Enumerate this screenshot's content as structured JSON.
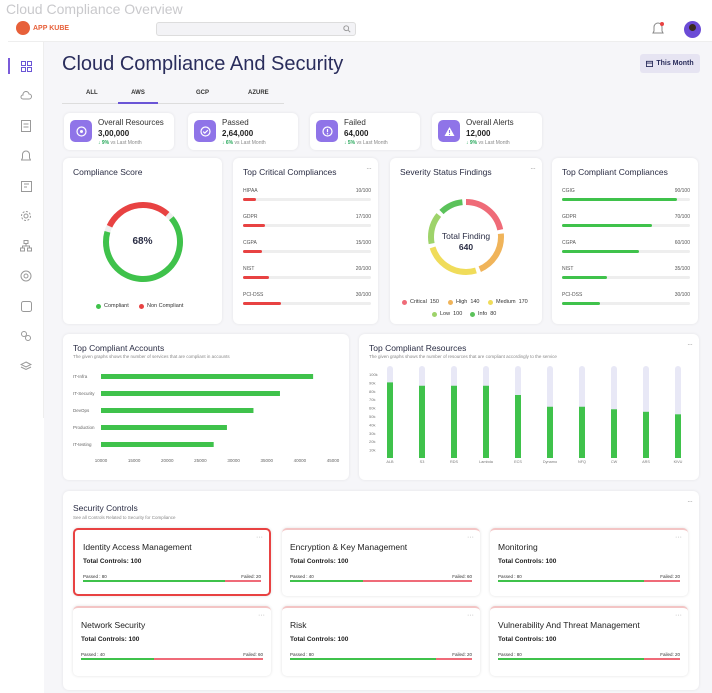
{
  "window_title": "Cloud Compliance Overview",
  "brand": {
    "name": "APP KUBE",
    "accent": "#e7603a"
  },
  "page": {
    "title": "Cloud Compliance And Security",
    "period_button": "This Month"
  },
  "tabs": [
    {
      "label": "ALL",
      "active": false
    },
    {
      "label": "AWS",
      "active": true
    },
    {
      "label": "GCP",
      "active": false
    },
    {
      "label": "AZURE",
      "active": false
    }
  ],
  "stats": [
    {
      "title": "Overall Resources",
      "value": "3,00,000",
      "change": "9%",
      "note": "vs Last Month",
      "icon": "cube-icon"
    },
    {
      "title": "Passed",
      "value": "2,64,000",
      "change": "6%",
      "note": "vs Last Month",
      "icon": "check-icon"
    },
    {
      "title": "Failed",
      "value": "64,000",
      "change": "5%",
      "note": "vs Last Month",
      "icon": "alert-circle-icon"
    },
    {
      "title": "Overall Alerts",
      "value": "12,000",
      "change": "9%",
      "note": "vs Last Month",
      "icon": "warning-icon"
    }
  ],
  "compliance_score": {
    "title": "Compliance Score",
    "value": "68%",
    "percent": 68,
    "legend": [
      {
        "label": "Compliant",
        "color": "#3fc24b"
      },
      {
        "label": "Non Compliant",
        "color": "#e84242"
      }
    ]
  },
  "critical": {
    "title": "Top Critical Compliances",
    "items": [
      {
        "name": "HIPAA",
        "score": "10/100",
        "value": 10
      },
      {
        "name": "GDPR",
        "score": "17/100",
        "value": 17
      },
      {
        "name": "CGPA",
        "score": "15/100",
        "value": 15
      },
      {
        "name": "NIST",
        "score": "20/100",
        "value": 20
      },
      {
        "name": "PCI-DSS",
        "score": "30/100",
        "value": 30
      }
    ]
  },
  "severity": {
    "title": "Severity Status Findings",
    "center_label": "Total Finding",
    "center_value": "640",
    "items": [
      {
        "label": "Critical",
        "value": 150,
        "color": "#ef6b78"
      },
      {
        "label": "High",
        "value": 140,
        "color": "#f0b45a"
      },
      {
        "label": "Medium",
        "value": 170,
        "color": "#f0dc5a"
      },
      {
        "label": "Low",
        "value": 100,
        "color": "#9ed36a"
      },
      {
        "label": "Info",
        "value": 80,
        "color": "#5bc25a"
      }
    ]
  },
  "top_compliant": {
    "title": "Top Compliant Compliances",
    "items": [
      {
        "name": "CGIG",
        "score": "90/100",
        "value": 90
      },
      {
        "name": "GDPR",
        "score": "70/100",
        "value": 70
      },
      {
        "name": "CGPA",
        "score": "60/100",
        "value": 60
      },
      {
        "name": "NIST",
        "score": "35/100",
        "value": 35
      },
      {
        "name": "PCI-DSS",
        "score": "30/100",
        "value": 30
      }
    ]
  },
  "accounts": {
    "title": "Top Compliant Accounts",
    "subtitle": "The given graphs shows the number of services that are compliant in accounts",
    "x_ticks": [
      "10000",
      "15000",
      "20000",
      "25000",
      "30000",
      "35000",
      "40000",
      "45000"
    ],
    "chart_data": {
      "type": "bar",
      "categories": [
        "IT-Infra",
        "IT-Security",
        "DevOps",
        "Production",
        "IT-testing"
      ],
      "values": [
        42000,
        37000,
        33000,
        29000,
        27000
      ],
      "xlim": [
        10000,
        45000
      ]
    }
  },
  "resources": {
    "title": "Top Compliant Resources",
    "subtitle": "The given graphs shows the number of resources that are compliant accordingly to the service",
    "y_ticks": [
      "100k",
      "90k",
      "80k",
      "70k",
      "60k",
      "50k",
      "40k",
      "30k",
      "20k",
      "10k"
    ],
    "chart_data": {
      "type": "bar",
      "categories": [
        "ALB",
        "S3",
        "RDS",
        "Lambda",
        "ECS",
        "Dynamo",
        "NFQ",
        "CW",
        "ARS",
        "KIVU"
      ],
      "values": [
        90,
        86,
        86,
        86,
        75,
        61,
        61,
        58,
        55,
        52
      ],
      "max": 100,
      "ylim": [
        0,
        100000
      ]
    }
  },
  "security": {
    "title": "Security Controls",
    "subtitle": "See all Controls Related to Security for Compliance",
    "items": [
      {
        "name": "Identity Access Management",
        "total": "Total Controls: 100",
        "passed": "Passed : 80",
        "failed": "Failed: 20",
        "pass_pct": 80,
        "selected": true
      },
      {
        "name": "Encryption & Key Management",
        "total": "Total Controls: 100",
        "passed": "Passed : 40",
        "failed": "Failed: 60",
        "pass_pct": 40,
        "selected": false
      },
      {
        "name": "Monitoring",
        "total": "Total Controls: 100",
        "passed": "Passed : 80",
        "failed": "Failed: 20",
        "pass_pct": 80,
        "selected": false
      },
      {
        "name": "Network Security",
        "total": "Total Controls: 100",
        "passed": "Passed : 40",
        "failed": "Failed: 60",
        "pass_pct": 40,
        "selected": false
      },
      {
        "name": "Risk",
        "total": "Total Controls: 100",
        "passed": "Passed : 80",
        "failed": "Failed: 20",
        "pass_pct": 80,
        "selected": false
      },
      {
        "name": "Vulnerability And Threat Management",
        "total": "Total Controls: 100",
        "passed": "Passed : 80",
        "failed": "Failed: 20",
        "pass_pct": 80,
        "selected": false
      }
    ]
  },
  "colors": {
    "green": "#3fc24b",
    "red": "#e84242",
    "purple": "#8f74e8"
  }
}
